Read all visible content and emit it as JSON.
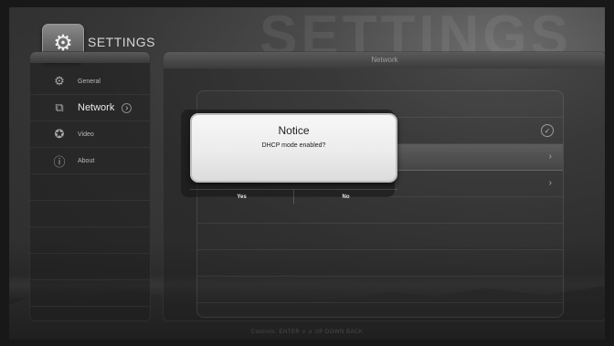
{
  "header": {
    "title": "SETTINGS",
    "watermark": "SETTINGS",
    "icon": "gear-icon"
  },
  "sidebar": {
    "items": [
      {
        "label": "General",
        "icon": "gears-icon",
        "active": false
      },
      {
        "label": "Network",
        "icon": "network-icon",
        "active": true,
        "arrow": "›"
      },
      {
        "label": "Video",
        "icon": "film-reel-icon",
        "active": false
      },
      {
        "label": "About",
        "icon": "info-icon",
        "active": false
      }
    ]
  },
  "main": {
    "title": "Network",
    "rows": [
      {
        "right": "",
        "type": "blank"
      },
      {
        "right": "✓",
        "type": "check"
      },
      {
        "right": "›",
        "type": "arrow",
        "highlight": true
      },
      {
        "right": "›",
        "type": "arrow"
      }
    ]
  },
  "dialog": {
    "title": "Notice",
    "message": "DHCP mode enabled?",
    "yes_label": "Yes",
    "no_label": "No"
  },
  "footer": {
    "text": "Controls: ENTER  ∨  ∧  UP  DOWN  BACK"
  },
  "colors": {
    "dialog_bg": "#efefef",
    "highlight_row": "#525252",
    "text_light": "#d6d6d6"
  }
}
